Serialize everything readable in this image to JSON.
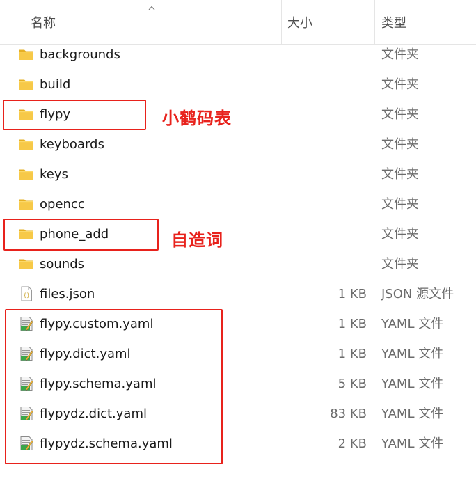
{
  "header": {
    "name": "名称",
    "size": "大小",
    "type": "类型"
  },
  "files": [
    {
      "name": "backgrounds",
      "size": "",
      "type": "文件夹",
      "icon": "folder-icon"
    },
    {
      "name": "build",
      "size": "",
      "type": "文件夹",
      "icon": "folder-icon"
    },
    {
      "name": "flypy",
      "size": "",
      "type": "文件夹",
      "icon": "folder-icon"
    },
    {
      "name": "keyboards",
      "size": "",
      "type": "文件夹",
      "icon": "folder-icon"
    },
    {
      "name": "keys",
      "size": "",
      "type": "文件夹",
      "icon": "folder-icon"
    },
    {
      "name": "opencc",
      "size": "",
      "type": "文件夹",
      "icon": "folder-icon"
    },
    {
      "name": "phone_add",
      "size": "",
      "type": "文件夹",
      "icon": "folder-icon"
    },
    {
      "name": "sounds",
      "size": "",
      "type": "文件夹",
      "icon": "folder-icon"
    },
    {
      "name": "files.json",
      "size": "1 KB",
      "type": "JSON 源文件",
      "icon": "json-file-icon"
    },
    {
      "name": "flypy.custom.yaml",
      "size": "1 KB",
      "type": "YAML 文件",
      "icon": "yaml-file-icon"
    },
    {
      "name": "flypy.dict.yaml",
      "size": "1 KB",
      "type": "YAML 文件",
      "icon": "yaml-file-icon"
    },
    {
      "name": "flypy.schema.yaml",
      "size": "5 KB",
      "type": "YAML 文件",
      "icon": "yaml-file-icon"
    },
    {
      "name": "flypydz.dict.yaml",
      "size": "83 KB",
      "type": "YAML 文件",
      "icon": "yaml-file-icon"
    },
    {
      "name": "flypydz.schema.yaml",
      "size": "2 KB",
      "type": "YAML 文件",
      "icon": "yaml-file-icon"
    }
  ],
  "annotations": {
    "flypy": "小鹤码表",
    "phone_add": "自造词"
  },
  "colors": {
    "annotation_red": "#e8221c",
    "folder_yellow": "#f4c542",
    "yaml_green": "#3aa64a"
  }
}
